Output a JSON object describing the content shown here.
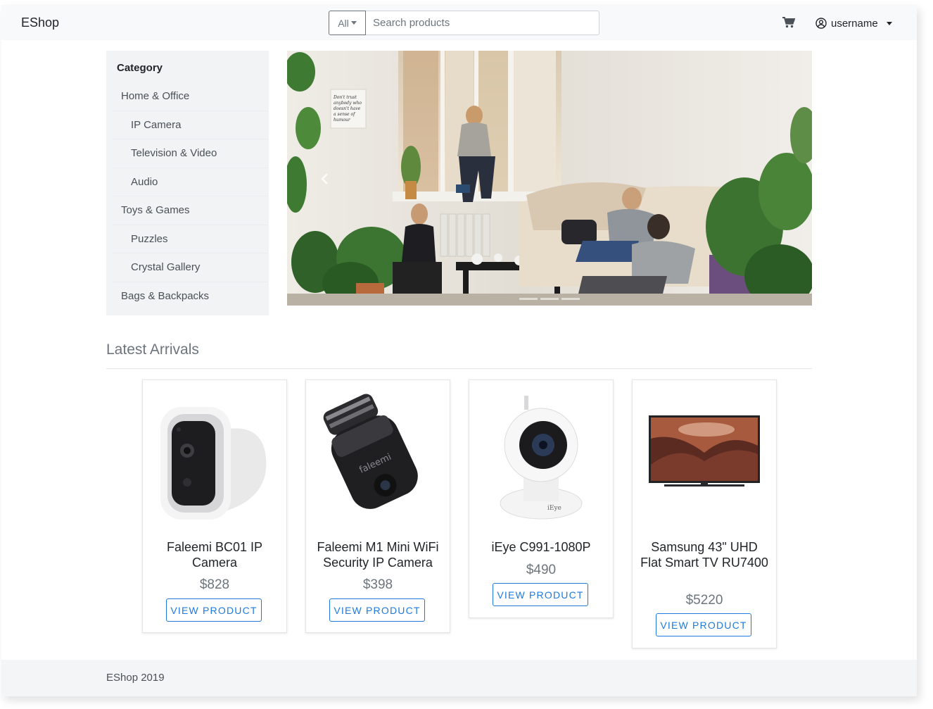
{
  "navbar": {
    "brand": "EShop",
    "category_select": "All",
    "search_placeholder": "Search products",
    "cart_icon": "cart-icon",
    "user_icon": "user-circle-icon",
    "username": "username"
  },
  "sidebar": {
    "title": "Category",
    "items": [
      {
        "label": "Home & Office"
      },
      {
        "label": "IP Camera"
      },
      {
        "label": "Television & Video"
      },
      {
        "label": "Audio"
      },
      {
        "label": "Toys & Games"
      },
      {
        "label": "Puzzles"
      },
      {
        "label": "Crystal Gallery"
      },
      {
        "label": "Bags & Backpacks"
      }
    ]
  },
  "hero": {
    "prev_icon": "chevron-left-icon",
    "note_text": [
      "Don't trust",
      "anybody who",
      "doesn't have",
      "a sense of",
      "humour"
    ]
  },
  "latest": {
    "title": "Latest Arrivals",
    "products": [
      {
        "name": "Faleemi BC01 IP Camera",
        "price": "$828",
        "button": "VIEW PRODUCT"
      },
      {
        "name": "Faleemi M1 Mini WiFi Security IP Camera",
        "price": "$398",
        "button": "VIEW PRODUCT",
        "logo": "faleemi"
      },
      {
        "name": "iEye C991-1080P",
        "price": "$490",
        "button": "VIEW PRODUCT",
        "logo": "iEye"
      },
      {
        "name": "Samsung 43\" UHD Flat Smart TV RU7400",
        "price": "$5220",
        "button": "VIEW PRODUCT"
      }
    ]
  },
  "footer": {
    "text": "EShop 2019"
  },
  "colors": {
    "accent": "#1e7ae0",
    "navbar_bg": "#f8f9fa",
    "sidebar_bg": "#f1f3f5",
    "muted": "#6c757d"
  }
}
